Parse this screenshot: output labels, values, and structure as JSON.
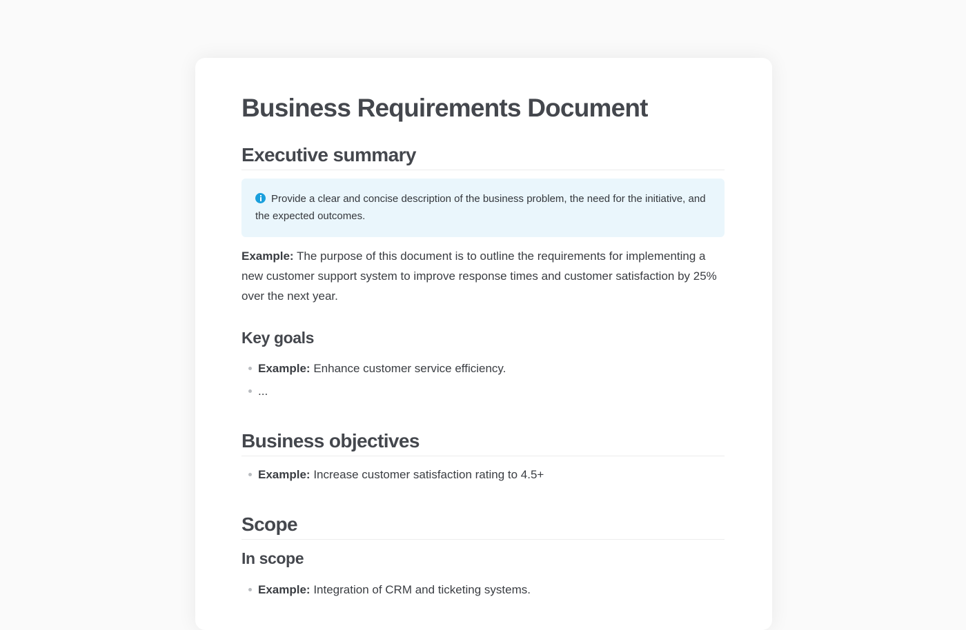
{
  "document": {
    "title": "Business Requirements Document"
  },
  "executive_summary": {
    "heading": "Executive summary",
    "callout_icon": "info-icon",
    "callout_text": "Provide a clear and concise description of the business problem, the need for the initiative, and the expected outcomes.",
    "example_label": "Example:",
    "example_text": " The purpose of this document is to outline the requirements for implementing a new customer support system to improve response times and customer satisfaction by 25% over the next year."
  },
  "key_goals": {
    "heading": "Key goals",
    "items": [
      {
        "label": "Example:",
        "text": " Enhance customer service efficiency."
      },
      {
        "label": "",
        "text": "..."
      }
    ]
  },
  "business_objectives": {
    "heading": "Business objectives",
    "items": [
      {
        "label": "Example:",
        "text": " Increase customer satisfaction rating to 4.5+"
      }
    ]
  },
  "scope": {
    "heading": "Scope",
    "in_scope": {
      "heading": "In scope",
      "items": [
        {
          "label": "Example:",
          "text": " Integration of CRM and ticketing systems."
        }
      ]
    }
  },
  "colors": {
    "background": "#fafafa",
    "page": "#ffffff",
    "callout_bg": "#eaf6fc",
    "info_icon": "#1a9fdc",
    "heading_text": "#44474d"
  }
}
